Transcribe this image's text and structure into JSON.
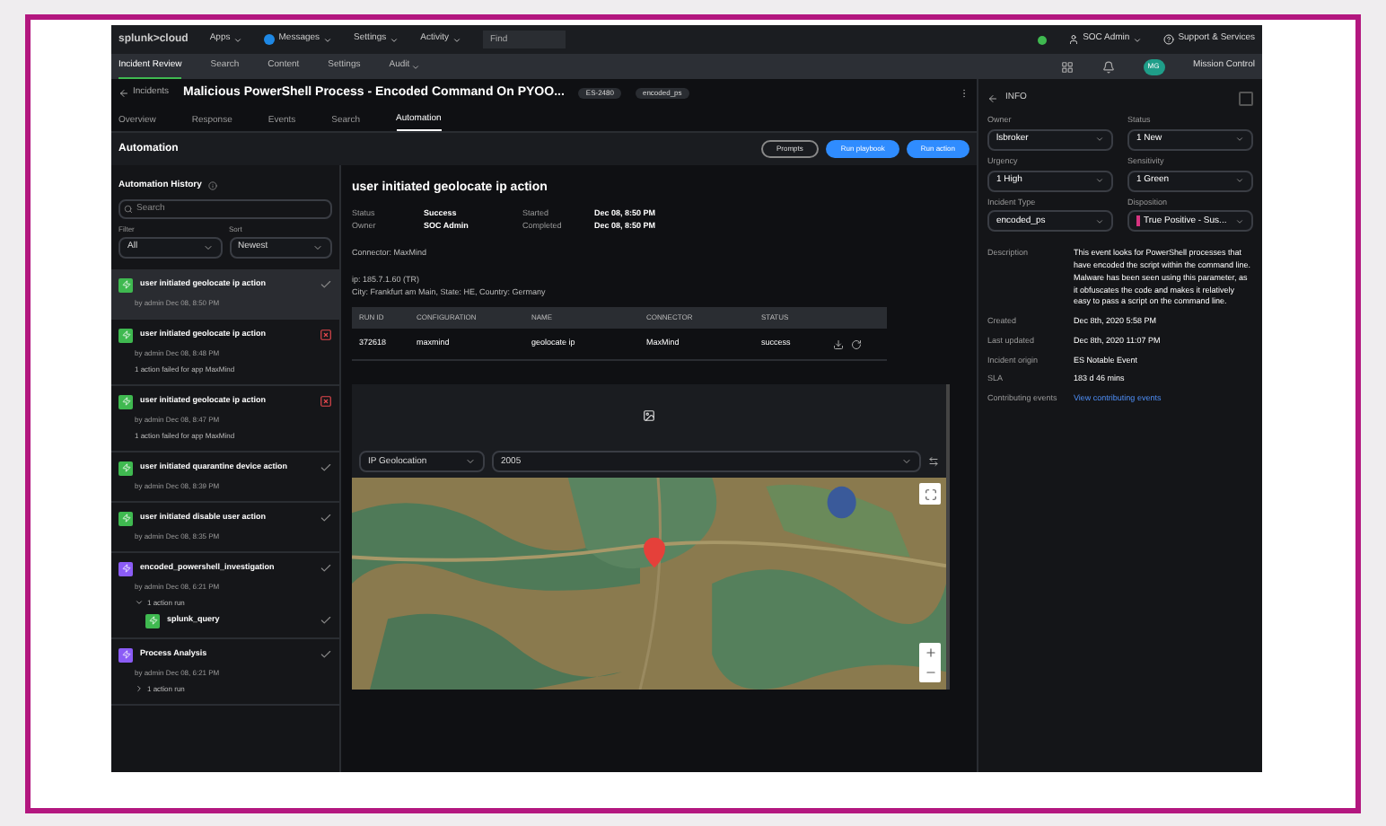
{
  "top_bar": {
    "logo": "splunk>cloud",
    "menus": [
      {
        "label": "Apps",
        "icon": false
      },
      {
        "label": "Messages",
        "icon": true
      },
      {
        "label": "Settings",
        "icon": false
      },
      {
        "label": "Activity",
        "icon": false
      }
    ],
    "find": {
      "placeholder": "Find"
    },
    "user": "SOC Admin",
    "support": "Support & Services"
  },
  "nav": {
    "items": [
      {
        "label": "Incident Review",
        "selected": true,
        "dropdown": false
      },
      {
        "label": "Search",
        "selected": false,
        "dropdown": false
      },
      {
        "label": "Content",
        "selected": false,
        "dropdown": false
      },
      {
        "label": "Settings",
        "selected": false,
        "dropdown": false
      },
      {
        "label": "Audit",
        "selected": false,
        "dropdown": true
      }
    ],
    "avatar": "MG",
    "app": "Mission Control"
  },
  "incident": {
    "back": "Incidents",
    "title": "Malicious PowerShell Process - Encoded Command On PYOO...",
    "tags": [
      "ES-2480",
      "encoded_ps"
    ]
  },
  "tabs": [
    {
      "label": "Overview",
      "selected": false
    },
    {
      "label": "Response",
      "selected": false
    },
    {
      "label": "Events",
      "selected": false
    },
    {
      "label": "Search",
      "selected": false
    },
    {
      "label": "Automation",
      "selected": true
    }
  ],
  "automation": {
    "heading": "Automation",
    "buttons": [
      {
        "label": "Prompts",
        "kind": "outline"
      },
      {
        "label": "Run playbook",
        "kind": "primary"
      },
      {
        "label": "Run action",
        "kind": "primary"
      }
    ]
  },
  "history": {
    "title": "Automation History",
    "search": {
      "placeholder": "Search"
    },
    "filter": {
      "label": "Filter",
      "value": "All"
    },
    "sort": {
      "label": "Sort",
      "value": "Newest"
    },
    "items": [
      {
        "kind": "action",
        "title": "user initiated geolocate ip action",
        "meta": "by admin Dec 08, 8:50 PM",
        "failed": false,
        "selected": true
      },
      {
        "kind": "action",
        "title": "user initiated geolocate ip action",
        "meta": "by admin Dec 08, 8:48 PM",
        "failed": true,
        "selected": false,
        "note": "1 action failed for app MaxMind"
      },
      {
        "kind": "action",
        "title": "user initiated geolocate ip action",
        "meta": "by admin Dec 08, 8:47 PM",
        "failed": true,
        "selected": false,
        "note": "1 action failed for app MaxMind"
      },
      {
        "kind": "action",
        "title": "user initiated quarantine device action",
        "meta": "by admin Dec 08, 8:39 PM",
        "failed": false,
        "selected": false
      },
      {
        "kind": "action",
        "title": "user initiated disable user action",
        "meta": "by admin Dec 08, 8:35 PM",
        "failed": false,
        "selected": false
      },
      {
        "kind": "playbook",
        "title": "encoded_powershell_investigation",
        "meta": "by admin Dec 08, 6:21 PM",
        "failed": false,
        "selected": false,
        "group": {
          "label": "1 action run",
          "expanded": true,
          "children": [
            {
              "kind": "action",
              "title": "splunk_query",
              "failed": false
            }
          ]
        }
      },
      {
        "kind": "playbook",
        "title": "Process Analysis",
        "meta": "by admin Dec 08, 6:21 PM",
        "failed": false,
        "selected": false,
        "group": {
          "label": "1 action run",
          "expanded": false
        }
      }
    ]
  },
  "detail": {
    "title": "user initiated geolocate ip action",
    "fields": [
      {
        "label": "Status",
        "value": "Success"
      },
      {
        "label": "Started",
        "value": "Dec 08, 8:50 PM"
      },
      {
        "label": "Owner",
        "value": "SOC Admin"
      },
      {
        "label": "Completed",
        "value": "Dec 08, 8:50 PM"
      }
    ],
    "connector": "Connector: MaxMind",
    "result_lines": [
      "ip: 185.7.1.60 (TR)",
      "City: Frankfurt am Main, State: HE, Country: Germany"
    ],
    "table": {
      "columns": [
        "RUN ID",
        "CONFIGURATION",
        "NAME",
        "CONNECTOR",
        "STATUS"
      ],
      "rows": [
        {
          "cells": [
            "372618",
            "maxmind",
            "geolocate ip",
            "MaxMind",
            "success"
          ]
        }
      ]
    },
    "geo": {
      "dropdown": "IP Geolocation",
      "value": "2005"
    }
  },
  "info": {
    "title": "INFO",
    "fields": [
      {
        "label": "Owner",
        "value": "lsbroker"
      },
      {
        "label": "Status",
        "value": "1 New"
      },
      {
        "label": "Urgency",
        "value": "1 High"
      },
      {
        "label": "Sensitivity",
        "value": "1 Green"
      },
      {
        "label": "Incident Type",
        "value": "encoded_ps"
      },
      {
        "label": "Disposition",
        "value": "True Positive - Sus...",
        "color": "#d6337f"
      }
    ],
    "details": [
      {
        "label": "Description",
        "value": "This event looks for PowerShell processes that have encoded the script within the command line. Malware has been seen using this parameter, as it obfuscates the code and makes it relatively easy to pass a script on the command line.",
        "kind": "text"
      },
      {
        "label": "Created",
        "value": "Dec 8th, 2020 5:58 PM",
        "kind": "text"
      },
      {
        "label": "Last updated",
        "value": "Dec 8th, 2020 11:07 PM",
        "kind": "text"
      },
      {
        "label": "Incident origin",
        "value": "ES Notable Event",
        "kind": "text"
      },
      {
        "label": "SLA",
        "value": "183 d 46 mins",
        "kind": "text"
      },
      {
        "label": "Contributing events",
        "value": "View contributing events",
        "kind": "link"
      }
    ]
  }
}
